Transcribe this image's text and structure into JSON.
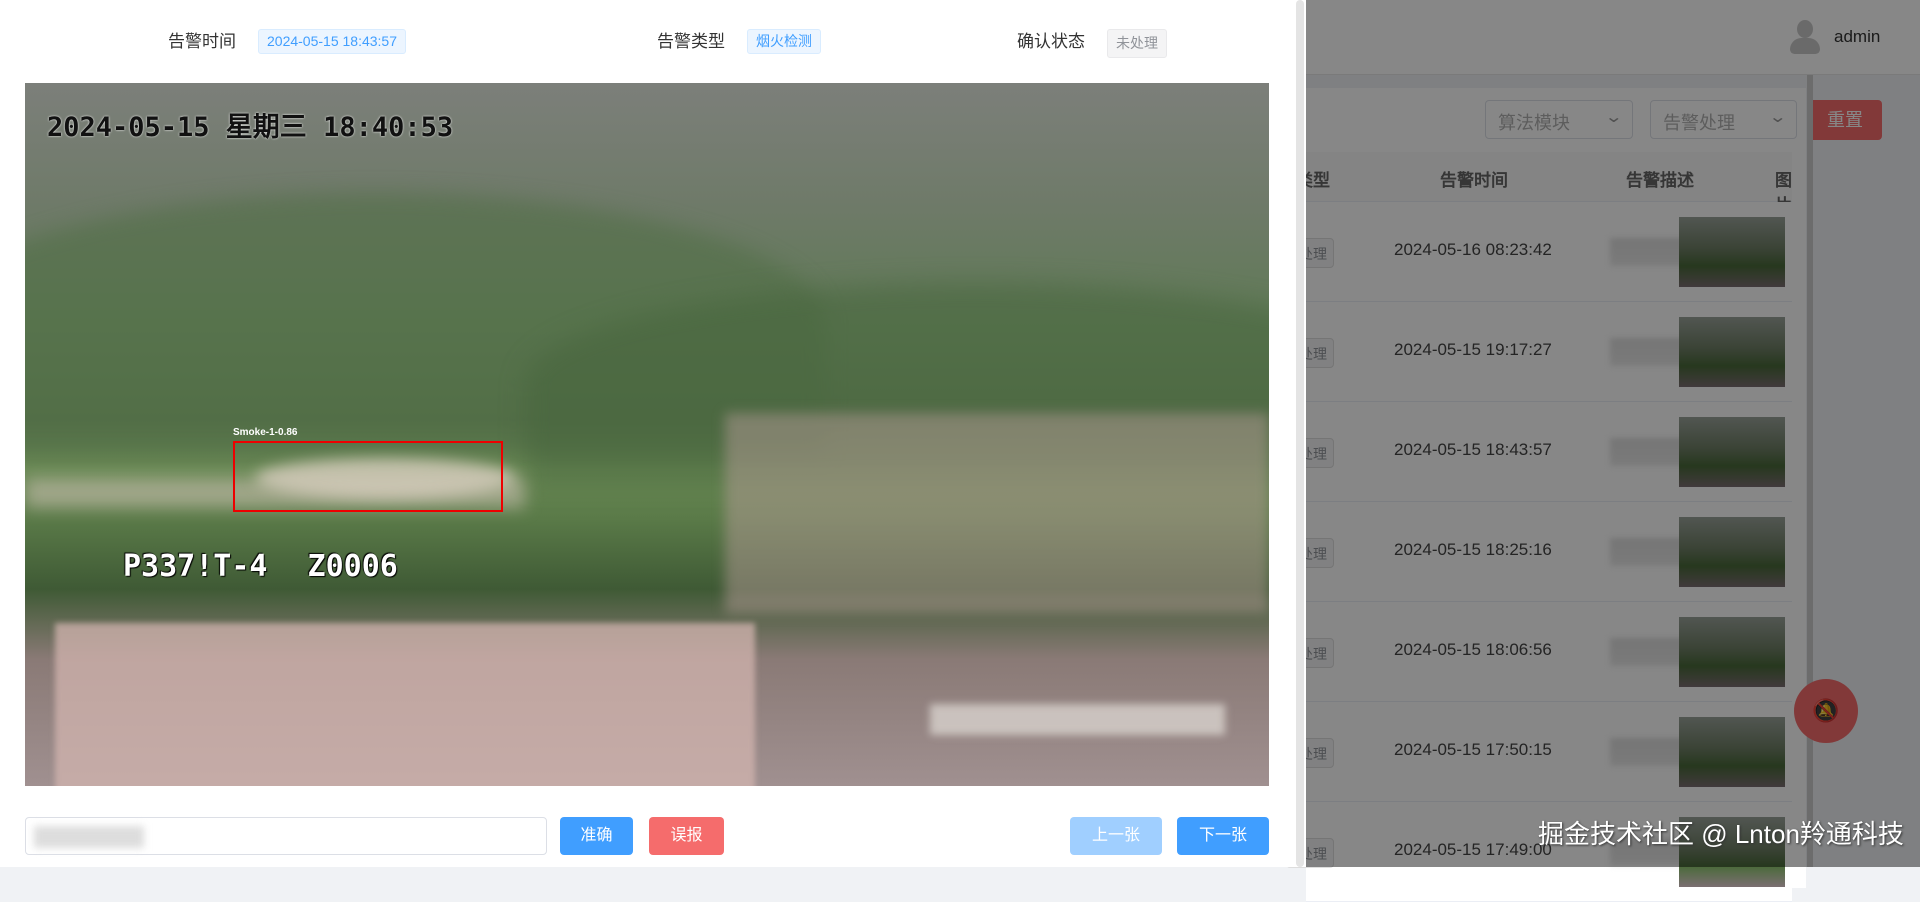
{
  "background": {
    "user": "admin",
    "filters": {
      "algorithm_placeholder": "算法模块",
      "handling_placeholder": "告警处理",
      "reset_label": "重置"
    },
    "table": {
      "headers": [
        "类型",
        "告警时间",
        "告警描述",
        "图片"
      ],
      "rows": [
        {
          "status": "处理",
          "time": "2024-05-16 08:23:42"
        },
        {
          "status": "处理",
          "time": "2024-05-15 19:17:27"
        },
        {
          "status": "处理",
          "time": "2024-05-15 18:43:57"
        },
        {
          "status": "处理",
          "time": "2024-05-15 18:25:16"
        },
        {
          "status": "处理",
          "time": "2024-05-15 18:06:56"
        },
        {
          "status": "处理",
          "time": "2024-05-15 17:50:15"
        },
        {
          "status": "处理",
          "time": "2024-05-15 17:49:00"
        }
      ]
    },
    "fab_icon": "bell-off-icon",
    "watermark": "掘金技术社区 @ Lnton羚通科技"
  },
  "modal": {
    "alarm_time_label": "告警时间",
    "alarm_time": "2024-05-15 18:43:57",
    "alarm_type_label": "告警类型",
    "alarm_type": "烟火检测",
    "confirm_label": "确认状态",
    "confirm_status": "未处理",
    "photo": {
      "timestamp": "2024-05-15 星期三 18:40:53",
      "camera_id": "P337!T-4 Z0006",
      "detection_label": "Smoke-1-0.86"
    },
    "buttons": {
      "accurate": "准确",
      "false_alarm": "误报",
      "prev": "上一张",
      "next": "下一张"
    },
    "colors": {
      "primary": "#409eff",
      "danger": "#f56c6c",
      "primary_light": "#79bbff"
    }
  }
}
